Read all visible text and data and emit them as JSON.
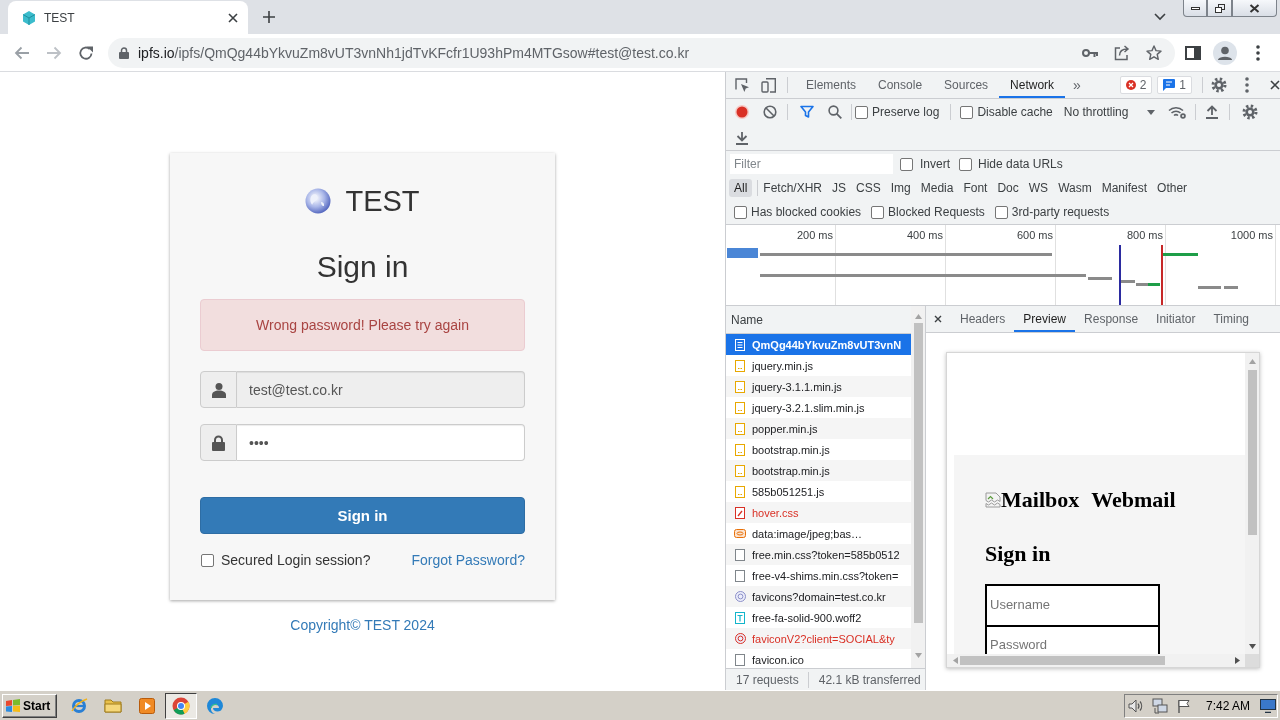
{
  "browser": {
    "tab": {
      "title": "TEST"
    },
    "address": {
      "host": "ipfs.io",
      "path": "/ipfs/QmQg44bYkvuZm8vUT3vnNh1jdTvKFcfr1U93hPm4MTGsow#test@test.co.kr"
    }
  },
  "login": {
    "brand": "TEST",
    "heading": "Sign in",
    "alert": "Wrong password! Please try again",
    "email": {
      "value": "test@test.co.kr",
      "readonly": true
    },
    "password": {
      "value": "••••",
      "readonly": false
    },
    "submit": "Sign in",
    "remember": {
      "label": "Secured Login session?",
      "checked": false
    },
    "forgot": "Forgot Password?",
    "footer": "Copyright© TEST 2024"
  },
  "devtools": {
    "tabs": [
      {
        "label": "Elements",
        "selected": false
      },
      {
        "label": "Console",
        "selected": false
      },
      {
        "label": "Sources",
        "selected": false
      },
      {
        "label": "Network",
        "selected": true
      }
    ],
    "more": "»",
    "errors": "2",
    "messages": "1",
    "preserve_log": {
      "label": "Preserve log",
      "checked": false
    },
    "disable_cache": {
      "label": "Disable cache",
      "checked": false
    },
    "throttling": "No throttling",
    "filter": {
      "placeholder": "Filter"
    },
    "invert": {
      "label": "Invert",
      "checked": false
    },
    "hide_data_urls": {
      "label": "Hide data URLs",
      "checked": false
    },
    "types": [
      {
        "label": "All",
        "selected": true
      },
      {
        "label": "Fetch/XHR",
        "selected": false
      },
      {
        "label": "JS",
        "selected": false
      },
      {
        "label": "CSS",
        "selected": false
      },
      {
        "label": "Img",
        "selected": false
      },
      {
        "label": "Media",
        "selected": false
      },
      {
        "label": "Font",
        "selected": false
      },
      {
        "label": "Doc",
        "selected": false
      },
      {
        "label": "WS",
        "selected": false
      },
      {
        "label": "Wasm",
        "selected": false
      },
      {
        "label": "Manifest",
        "selected": false
      },
      {
        "label": "Other",
        "selected": false
      }
    ],
    "options": [
      {
        "label": "Has blocked cookies",
        "checked": false
      },
      {
        "label": "Blocked Requests",
        "checked": false
      },
      {
        "label": "3rd-party requests",
        "checked": false
      }
    ],
    "timeline": {
      "ticks": [
        "200 ms",
        "400 ms",
        "600 ms",
        "800 ms",
        "1000 ms"
      ]
    },
    "requests": {
      "column": "Name",
      "rows": [
        {
          "name": "QmQg44bYkvuZm8vUT3vnN",
          "kind": "document",
          "selected": true,
          "failed": false
        },
        {
          "name": "jquery.min.js",
          "kind": "script",
          "selected": false,
          "failed": false
        },
        {
          "name": "jquery-3.1.1.min.js",
          "kind": "script",
          "selected": false,
          "failed": false
        },
        {
          "name": "jquery-3.2.1.slim.min.js",
          "kind": "script",
          "selected": false,
          "failed": false
        },
        {
          "name": "popper.min.js",
          "kind": "script",
          "selected": false,
          "failed": false
        },
        {
          "name": "bootstrap.min.js",
          "kind": "script",
          "selected": false,
          "failed": false
        },
        {
          "name": "bootstrap.min.js",
          "kind": "script",
          "selected": false,
          "failed": false
        },
        {
          "name": "585b051251.js",
          "kind": "script",
          "selected": false,
          "failed": false
        },
        {
          "name": "hover.css",
          "kind": "stylesheet",
          "selected": false,
          "failed": true
        },
        {
          "name": "data:image/jpeg;bas…",
          "kind": "image",
          "selected": false,
          "failed": false
        },
        {
          "name": "free.min.css?token=585b0512",
          "kind": "resource",
          "selected": false,
          "failed": false
        },
        {
          "name": "free-v4-shims.min.css?token=",
          "kind": "resource",
          "selected": false,
          "failed": false
        },
        {
          "name": "favicons?domain=test.co.kr",
          "kind": "fetch",
          "selected": false,
          "failed": false
        },
        {
          "name": "free-fa-solid-900.woff2",
          "kind": "font",
          "selected": false,
          "failed": false
        },
        {
          "name": "faviconV2?client=SOCIAL&ty",
          "kind": "fetch",
          "selected": false,
          "failed": true
        },
        {
          "name": "favicon.ico",
          "kind": "resource",
          "selected": false,
          "failed": false
        }
      ]
    },
    "detail_tabs": [
      {
        "label": "Headers",
        "selected": false
      },
      {
        "label": "Preview",
        "selected": true
      },
      {
        "label": "Response",
        "selected": false
      },
      {
        "label": "Initiator",
        "selected": false
      },
      {
        "label": "Timing",
        "selected": false
      }
    ],
    "preview": {
      "image_alt": "Mailbox",
      "title": "Webmail",
      "heading": "Sign in",
      "fields": [
        {
          "placeholder": "Username"
        },
        {
          "placeholder": "Password"
        }
      ]
    },
    "status": {
      "requests": "17 requests",
      "transferred": "42.1 kB transferred"
    }
  },
  "taskbar": {
    "start": "Start",
    "apps": [
      {
        "kind": "ie",
        "selected": false
      },
      {
        "kind": "folder",
        "selected": false
      },
      {
        "kind": "media",
        "selected": false
      },
      {
        "kind": "chrome",
        "selected": true
      },
      {
        "kind": "edge",
        "selected": false
      }
    ],
    "clock": "7:42 AM"
  }
}
